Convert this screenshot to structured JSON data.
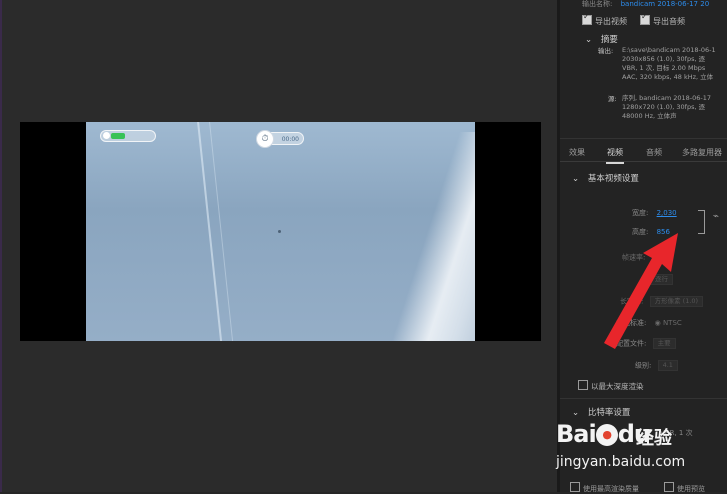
{
  "preview": {
    "timer_text": "00:00"
  },
  "export": {
    "output_name_label": "输出名称:",
    "output_name_value": "bandicam 2018-06-17 20",
    "export_video_label": "导出视频",
    "export_audio_label": "导出音频",
    "export_video_checked": true,
    "export_audio_checked": true
  },
  "summary": {
    "title": "摘要",
    "output_label": "输出:",
    "output_lines": [
      "E:\\save\\bandicam 2018-06-1",
      "2030x856 (1.0), 30fps, 逐",
      "VBR, 1 次, 目标 2.00 Mbps",
      "AAC, 320 kbps, 48 kHz, 立体"
    ],
    "source_label": "源:",
    "source_lines": [
      "序列, bandicam 2018-06-17",
      "1280x720 (1.0), 30fps, 逐",
      "48000 Hz, 立体声"
    ]
  },
  "tabs": [
    "效果",
    "视频",
    "音频",
    "多路复用器"
  ],
  "active_tab": "视频",
  "video_settings": {
    "section_title": "基本视频设置",
    "width_label": "宽度:",
    "width_value": "2,030",
    "height_label": "高度:",
    "height_value": "856",
    "frame_rate_label": "帧速率:",
    "field_order_value": "逐行",
    "aspect_label": "长宽比:",
    "aspect_value": "方形像素 (1.0)",
    "tv_standard_label": "电视标准:",
    "tv_standard_value": "NTSC",
    "profile_label": "配置文件:",
    "profile_value": "主要",
    "level_label": "级别:",
    "level_value": "4.1",
    "max_depth_label": "以最大深度渲染"
  },
  "bitrate": {
    "section_title": "比特率设置",
    "encoding_value": "VBR, 1 次"
  },
  "bottom_bar": {
    "left_label": "使用最高渲染质量",
    "right_label": "使用预览"
  },
  "watermark": {
    "logo_text_1": "Bai",
    "logo_text_2": "du",
    "paw": "●",
    "brand": "经验",
    "url": "jingyan.baidu.com"
  },
  "colors": {
    "accent_blue": "#2d8ceb",
    "arrow_red": "#e8262b",
    "panel_bg": "#232323"
  }
}
